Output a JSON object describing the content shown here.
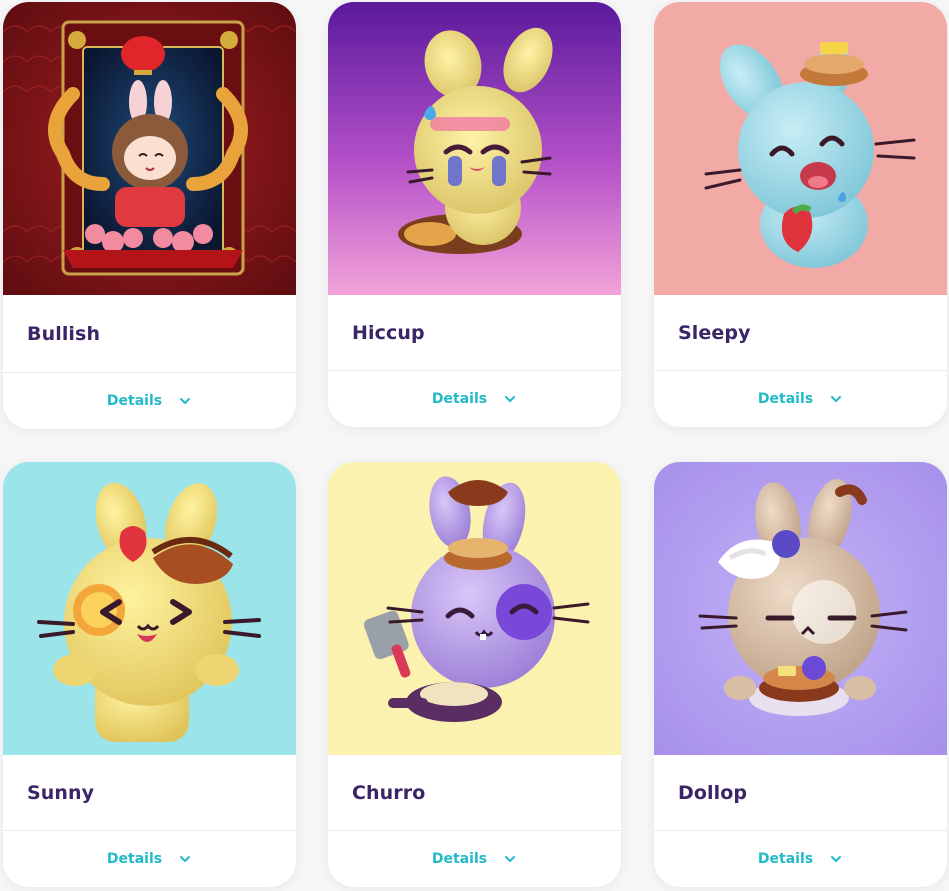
{
  "theme": {
    "title_color": "#3a2566",
    "accent_color": "#22b9c9"
  },
  "cards": [
    {
      "name": "Bullish",
      "details_label": "Details",
      "image_desc": "bunny-in-ox-costume",
      "bg": "#8a1a1c"
    },
    {
      "name": "Hiccup",
      "details_label": "Details",
      "image_desc": "crying-yellow-bunny-with-pancake",
      "bg": "#8a34b8"
    },
    {
      "name": "Sleepy",
      "details_label": "Details",
      "image_desc": "sleepy-blue-bunny-with-strawberry",
      "bg": "#f2aaa6"
    },
    {
      "name": "Sunny",
      "details_label": "Details",
      "image_desc": "yellow-bunny-with-fried-egg-eye",
      "bg": "#9ae4ea"
    },
    {
      "name": "Churro",
      "details_label": "Details",
      "image_desc": "purple-bunny-with-spatula-and-pan",
      "bg": "#fbf2b0"
    },
    {
      "name": "Dollop",
      "details_label": "Details",
      "image_desc": "tan-bunny-with-whipped-cream-and-pancakes",
      "bg": "#b9a6f2"
    }
  ]
}
